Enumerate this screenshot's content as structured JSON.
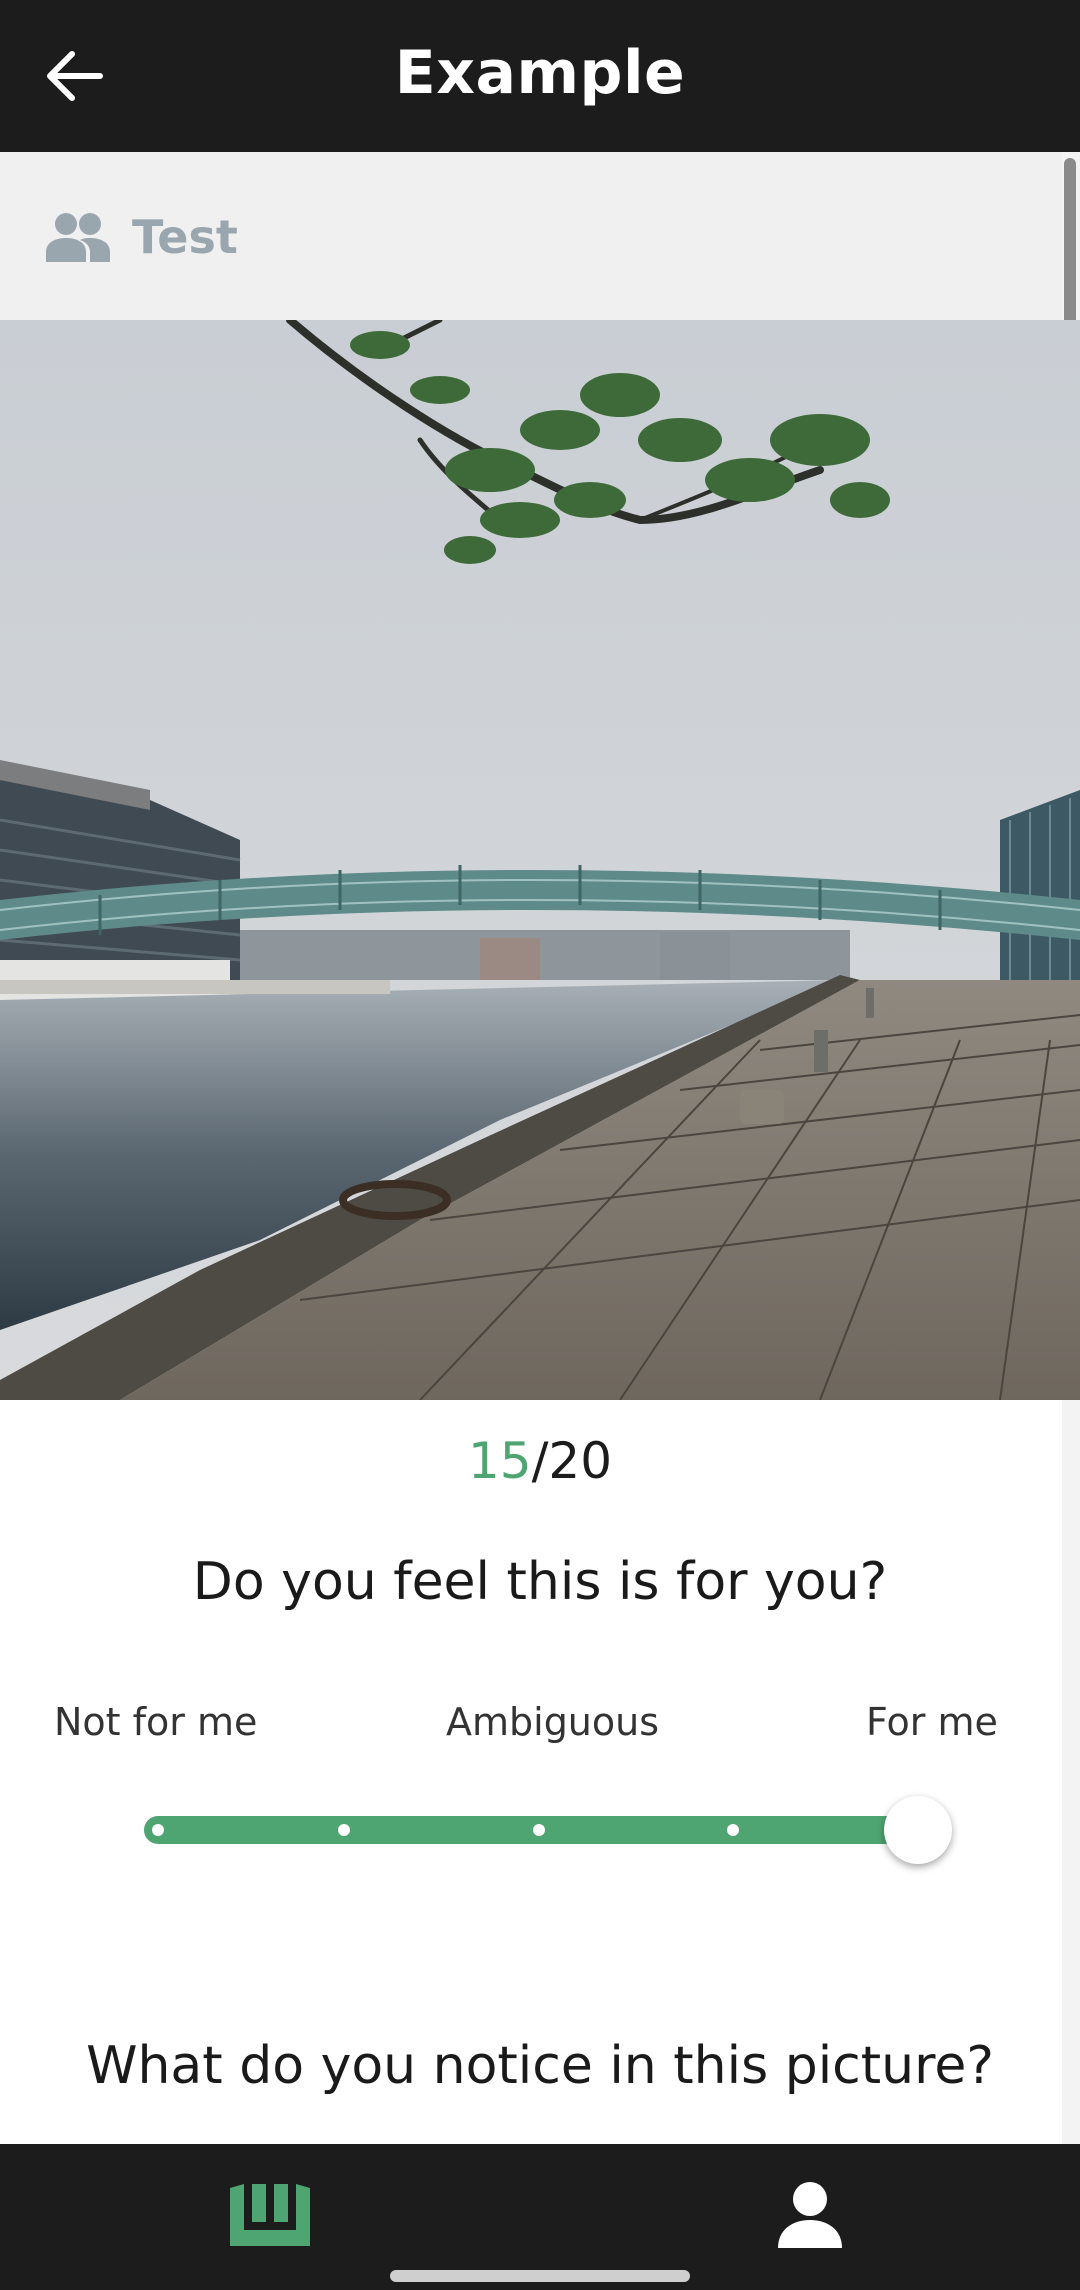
{
  "header": {
    "title": "Example",
    "back_icon": "arrow-left-icon"
  },
  "group": {
    "icon": "people-icon",
    "label": "Test"
  },
  "photo": {
    "alt": "Harbour promenade with footbridge"
  },
  "progress": {
    "current": "15",
    "separator_total": "/20"
  },
  "question_1": {
    "text": "Do you feel this is for you?",
    "scale": {
      "left": "Not for me",
      "middle": "Ambiguous",
      "right": "For me",
      "value": 1.0
    }
  },
  "question_2": {
    "text": "What do you notice in this picture?"
  },
  "bottom_nav": {
    "home_icon": "app-logo-icon",
    "profile_icon": "user-icon"
  },
  "colors": {
    "accent": "#4ea571",
    "bar": "#1c1c1c",
    "muted": "#9aa6ae"
  }
}
